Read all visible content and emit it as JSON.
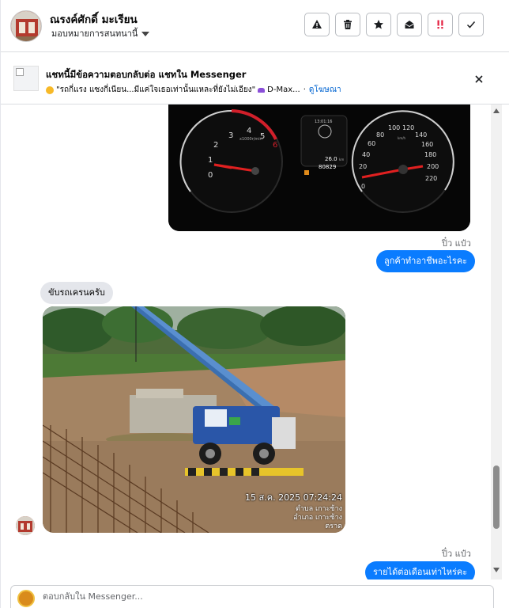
{
  "header": {
    "contact_name": "ณรงค์ศักดิ์ มะเรียน",
    "assign_label": "มอบหมายการสนทนานี้",
    "actions": [
      {
        "name": "report-spam-button",
        "icon": "warning-icon"
      },
      {
        "name": "delete-button",
        "icon": "trash-icon"
      },
      {
        "name": "star-button",
        "icon": "star-icon"
      },
      {
        "name": "mark-unread-button",
        "icon": "envelope-open-icon"
      },
      {
        "name": "follow-up-button",
        "icon": "exclamation-icon"
      },
      {
        "name": "mark-done-button",
        "icon": "check-icon"
      }
    ]
  },
  "banner": {
    "title": "แชทนี้มีข้อความตอบกลับต่อ แชทใน Messenger",
    "ad_text": "\"รถกี่แรง แซงกี่เนียน...มีแค่ใจเธอเท่านั้นแหละที่ยังไม่เอียง\"",
    "product": "D-Max...",
    "ad_link": "ดูโฆษณา"
  },
  "messages": {
    "sender_label_1": "ปิ๋ว แป๋ว",
    "outgoing_1": "ลูกค้าทำอาชีพอะไรคะ",
    "incoming_1": "ขับรถเครนครับ",
    "photo_timestamp": "15 ส.ค. 2025 07:24:24",
    "photo_location_1": "ตำบล เกาะช้าง",
    "photo_location_2": "อำเภอ เกาะช้าง",
    "photo_location_3": "ตราด",
    "sender_label_2": "ปิ๋ว แป๋ว",
    "outgoing_2": "รายได้ต่อเดือนเท่าไหร่คะ"
  },
  "dashboard": {
    "tach_ticks": [
      "0",
      "1",
      "2",
      "3",
      "4",
      "5",
      "6"
    ],
    "tach_unit": "x1000r/min",
    "speed_ticks": [
      "0",
      "20",
      "40",
      "60",
      "80",
      "100",
      "120",
      "140",
      "160",
      "180",
      "200",
      "220"
    ],
    "speed_unit": "km/h",
    "clock": "13:01:16",
    "trip": "26.0",
    "odo": "80829",
    "trip_unit": "km"
  },
  "composer": {
    "placeholder": "ตอบกลับใน Messenger..."
  },
  "colors": {
    "accent": "#0a7cff",
    "link": "#0064d1",
    "bubble_in": "#e4e6eb"
  }
}
